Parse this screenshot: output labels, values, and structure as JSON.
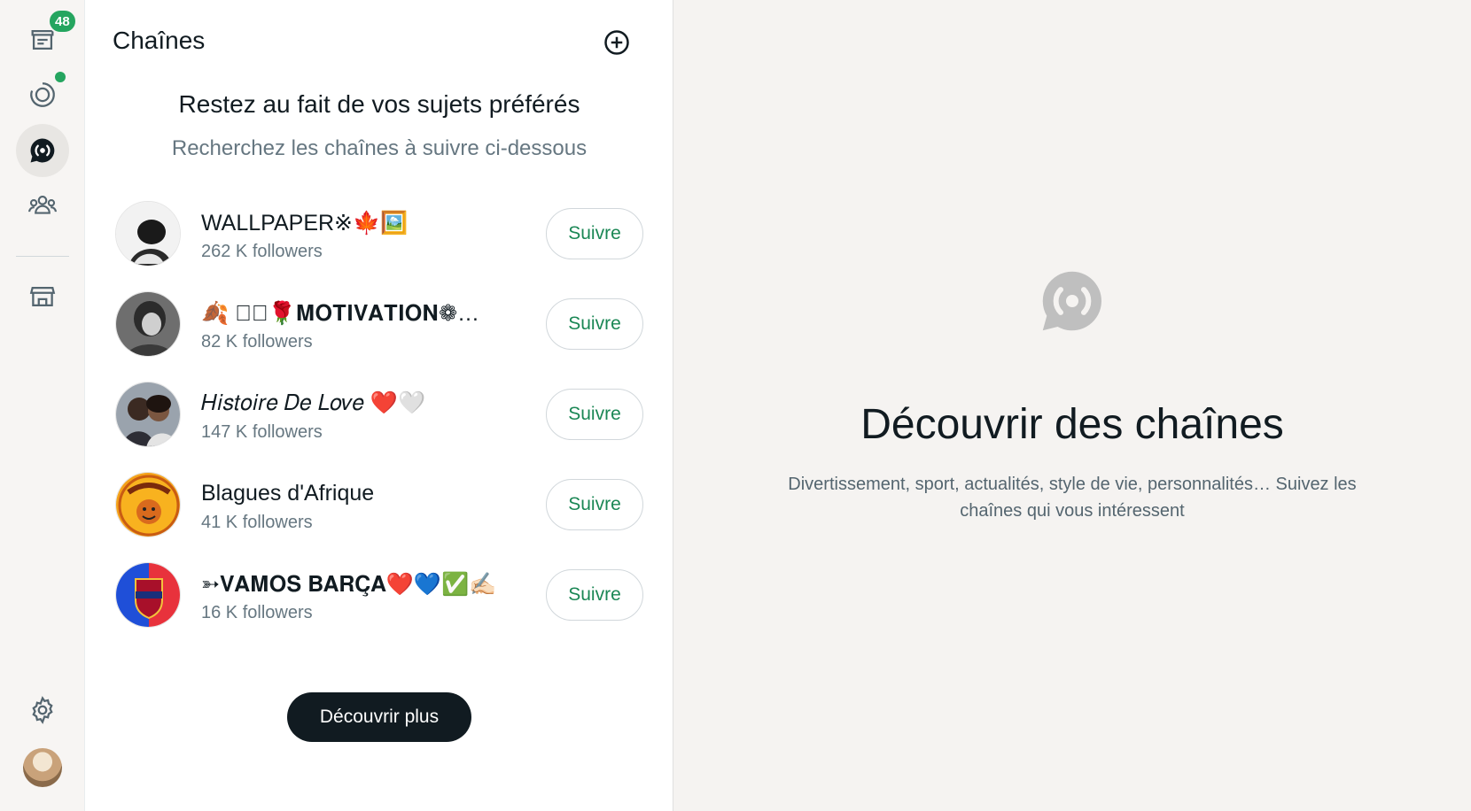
{
  "rail": {
    "chats_badge": "48",
    "items": [
      "chats-icon",
      "status-icon",
      "channels-icon",
      "communities-icon",
      "store-icon",
      "settings-icon"
    ]
  },
  "panel": {
    "title": "Chaînes",
    "intro_title": "Restez au fait de vos sujets préférés",
    "intro_sub": "Recherchez les chaînes à suivre ci-dessous",
    "channels": [
      {
        "name": "WALLPAPER※🍁🖼️",
        "followers": "262 K followers",
        "follow_label": "Suivre"
      },
      {
        "name": "🍂 ❀꙰🌹𝐌𝐎𝐓𝐈𝐕𝐀𝐓𝐈𝐎𝐍❁…",
        "followers": "82 K followers",
        "follow_label": "Suivre"
      },
      {
        "name": "𝐻𝑖𝑠𝑡𝑜𝑖𝑟𝑒 𝐷𝑒 𝐿𝑜𝑣𝑒 ❤️🤍",
        "followers": "147 K followers",
        "follow_label": "Suivre"
      },
      {
        "name": "Blagues d'Afrique",
        "followers": "41 K followers",
        "follow_label": "Suivre"
      },
      {
        "name": "➳𝐕𝐀𝐌𝐎𝐒 𝐁𝐀𝐑𝐂̧𝐀❤️💙✅✍🏻",
        "followers": "16 K followers",
        "follow_label": "Suivre"
      }
    ],
    "discover_label": "Découvrir plus"
  },
  "main": {
    "title": "Découvrir des chaînes",
    "subtitle": "Divertissement, sport, actualités, style de vie, personnalités… Suivez les chaînes qui vous intéressent"
  },
  "colors": {
    "accent_green": "#25a55f",
    "follow_text": "#1b8755",
    "dark_button": "#111b21"
  }
}
